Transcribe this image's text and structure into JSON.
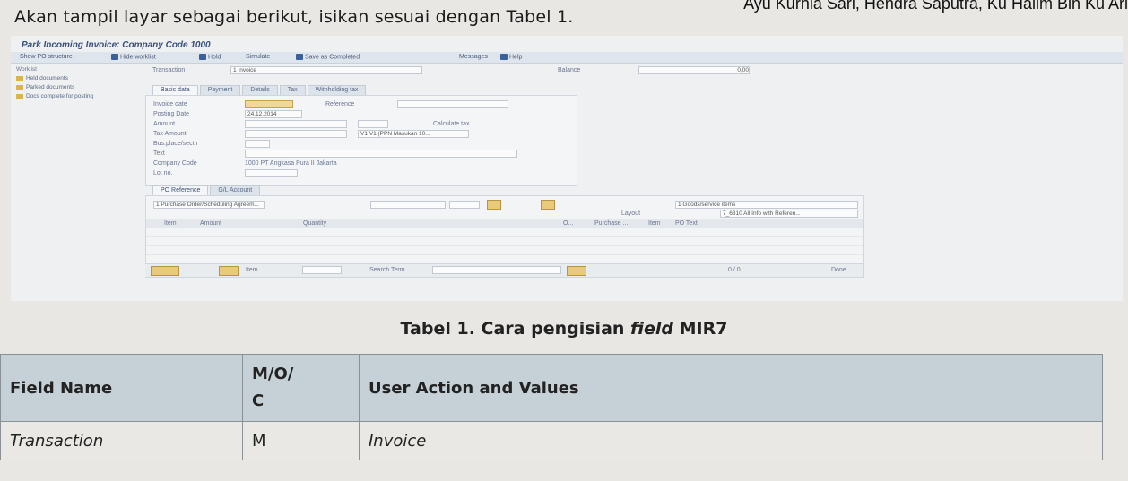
{
  "header": {
    "author_line": "Ayu Kurnia Sari, Hendra Saputra, Ku Halim Bin Ku Ari",
    "intro": "Akan tampil layar sebagai berikut, isikan sesuai dengan Tabel 1."
  },
  "sap": {
    "title": "Park Incoming Invoice: Company Code 1000",
    "toolbar": [
      "Show PO structure",
      "Hide worklist",
      "Hold",
      "Simulate",
      "Save as Completed",
      "Messages",
      "Help"
    ],
    "tree": [
      "Held documents",
      "Parked documents",
      "Docs complete for posting"
    ],
    "transaction_label": "Transaction",
    "transaction_value": "1 Invoice",
    "balance_label": "Balance",
    "balance_value": "0,00",
    "tabs": [
      "Basic data",
      "Payment",
      "Details",
      "Tax",
      "Withholding tax"
    ],
    "fields": {
      "invoice_date": "Invoice date",
      "reference": "Reference",
      "posting_date": "Posting Date",
      "posting_date_value": "24.12.2014",
      "amount": "Amount",
      "calculate_tax": "Calculate tax",
      "tax_amount": "Tax Amount",
      "tax_code_value": "V1 V1 (PPN Masukan 10...",
      "bus_place": "Bus.place/sectn",
      "text": "Text",
      "company_code": "Company Code",
      "company_code_value": "1000 PT Angkasa Pura II Jakarta",
      "lot_no": "Lot no."
    },
    "lower_tabs": [
      "PO Reference",
      "G/L Account"
    ],
    "po_select": "1 Purchase Order/Scheduling Agreem...",
    "goods_select": "1 Goods/service items",
    "layout_label": "Layout",
    "layout_value": "7_6310 All Info with Referen...",
    "grid_headers": [
      "Item",
      "Amount",
      "Quantity",
      "O...",
      "Purchase ...",
      "Item",
      "PO Text"
    ],
    "status": {
      "item": "Item",
      "search_term": "Search Term",
      "counter": "0 / 0",
      "done": "Done"
    }
  },
  "table": {
    "caption_pre": "Tabel 1. Cara pengisian ",
    "caption_em": "field",
    "caption_post": " MIR7",
    "headers": [
      "Field Name",
      "M/O/",
      "C",
      "User Action and Values"
    ],
    "rows": [
      {
        "field": "Transaction",
        "moc": "M",
        "action": "Invoice"
      }
    ]
  }
}
